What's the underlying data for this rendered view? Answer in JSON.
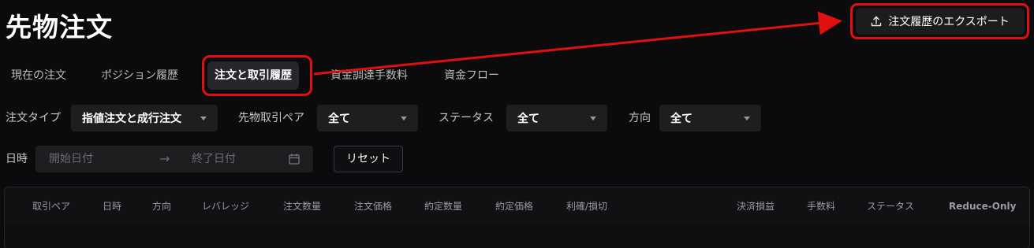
{
  "page_title": "先物注文",
  "export_button": {
    "label": "注文履歴のエクスポート",
    "icon": "upload-icon"
  },
  "tabs": [
    {
      "label": "現在の注文",
      "active": false
    },
    {
      "label": "ポジション履歴",
      "active": false
    },
    {
      "label": "注文と取引履歴",
      "active": true
    },
    {
      "label": "資金調達手数料",
      "active": false
    },
    {
      "label": "資金フロー",
      "active": false
    }
  ],
  "filters": {
    "order_type": {
      "label": "注文タイプ",
      "value": "指値注文と成行注文"
    },
    "pair": {
      "label": "先物取引ペア",
      "value": "全て"
    },
    "status": {
      "label": "ステータス",
      "value": "全て"
    },
    "direction": {
      "label": "方向",
      "value": "全て"
    }
  },
  "date_filter": {
    "label": "日時",
    "start_placeholder": "開始日付",
    "end_placeholder": "終了日付",
    "separator": "→"
  },
  "reset_button": {
    "label": "リセット"
  },
  "table": {
    "columns": [
      "取引ペア",
      "日時",
      "方向",
      "レバレッジ",
      "注文数量",
      "注文価格",
      "約定数量",
      "約定価格",
      "利確/損切",
      "決済損益",
      "手数料",
      "ステータス",
      "Reduce-Only"
    ]
  },
  "annotation": {
    "color": "#e01010"
  }
}
